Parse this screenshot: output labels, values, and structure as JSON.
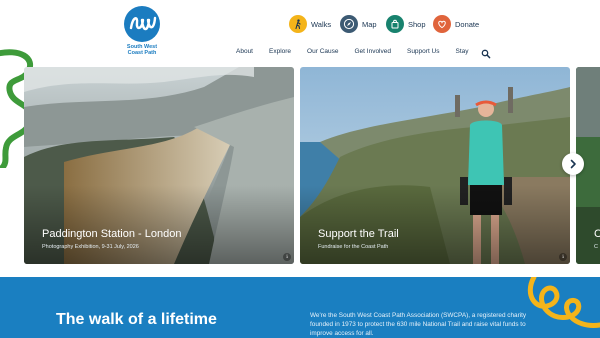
{
  "brand": {
    "name_line1": "South West",
    "name_line2": "Coast Path"
  },
  "quick_links": [
    {
      "label": "Walks",
      "icon": "walker-icon",
      "color": "#f4b41a"
    },
    {
      "label": "Map",
      "icon": "compass-icon",
      "color": "#3c5a73"
    },
    {
      "label": "Shop",
      "icon": "shopping-bag-icon",
      "color": "#18826e"
    },
    {
      "label": "Donate",
      "icon": "heart-icon",
      "color": "#e0643c"
    }
  ],
  "nav": {
    "items": [
      "About",
      "Explore",
      "Our Cause",
      "Get Involved",
      "Support Us",
      "Stay"
    ],
    "search_icon": "search-icon"
  },
  "carousel": {
    "cards": [
      {
        "title": "Paddington Station - London",
        "subtitle": "Photography Exhibition, 9-31 July, 2026",
        "info": "i"
      },
      {
        "title": "Support the Trail",
        "subtitle": "Fundraise for the Coast Path",
        "info": "i"
      },
      {
        "title": "C",
        "subtitle": "C"
      }
    ],
    "next_icon": "chevron-right-icon"
  },
  "intro": {
    "heading": "The walk of a lifetime",
    "text": "We're the South West Coast Path Association (SWCPA), a registered charity founded in 1973 to protect the 630 mile National Trail and raise vital funds to improve access for all."
  },
  "colors": {
    "brand_blue": "#1a7fc1",
    "accent_green": "#3e9b3a",
    "accent_yellow": "#f4b41a"
  }
}
